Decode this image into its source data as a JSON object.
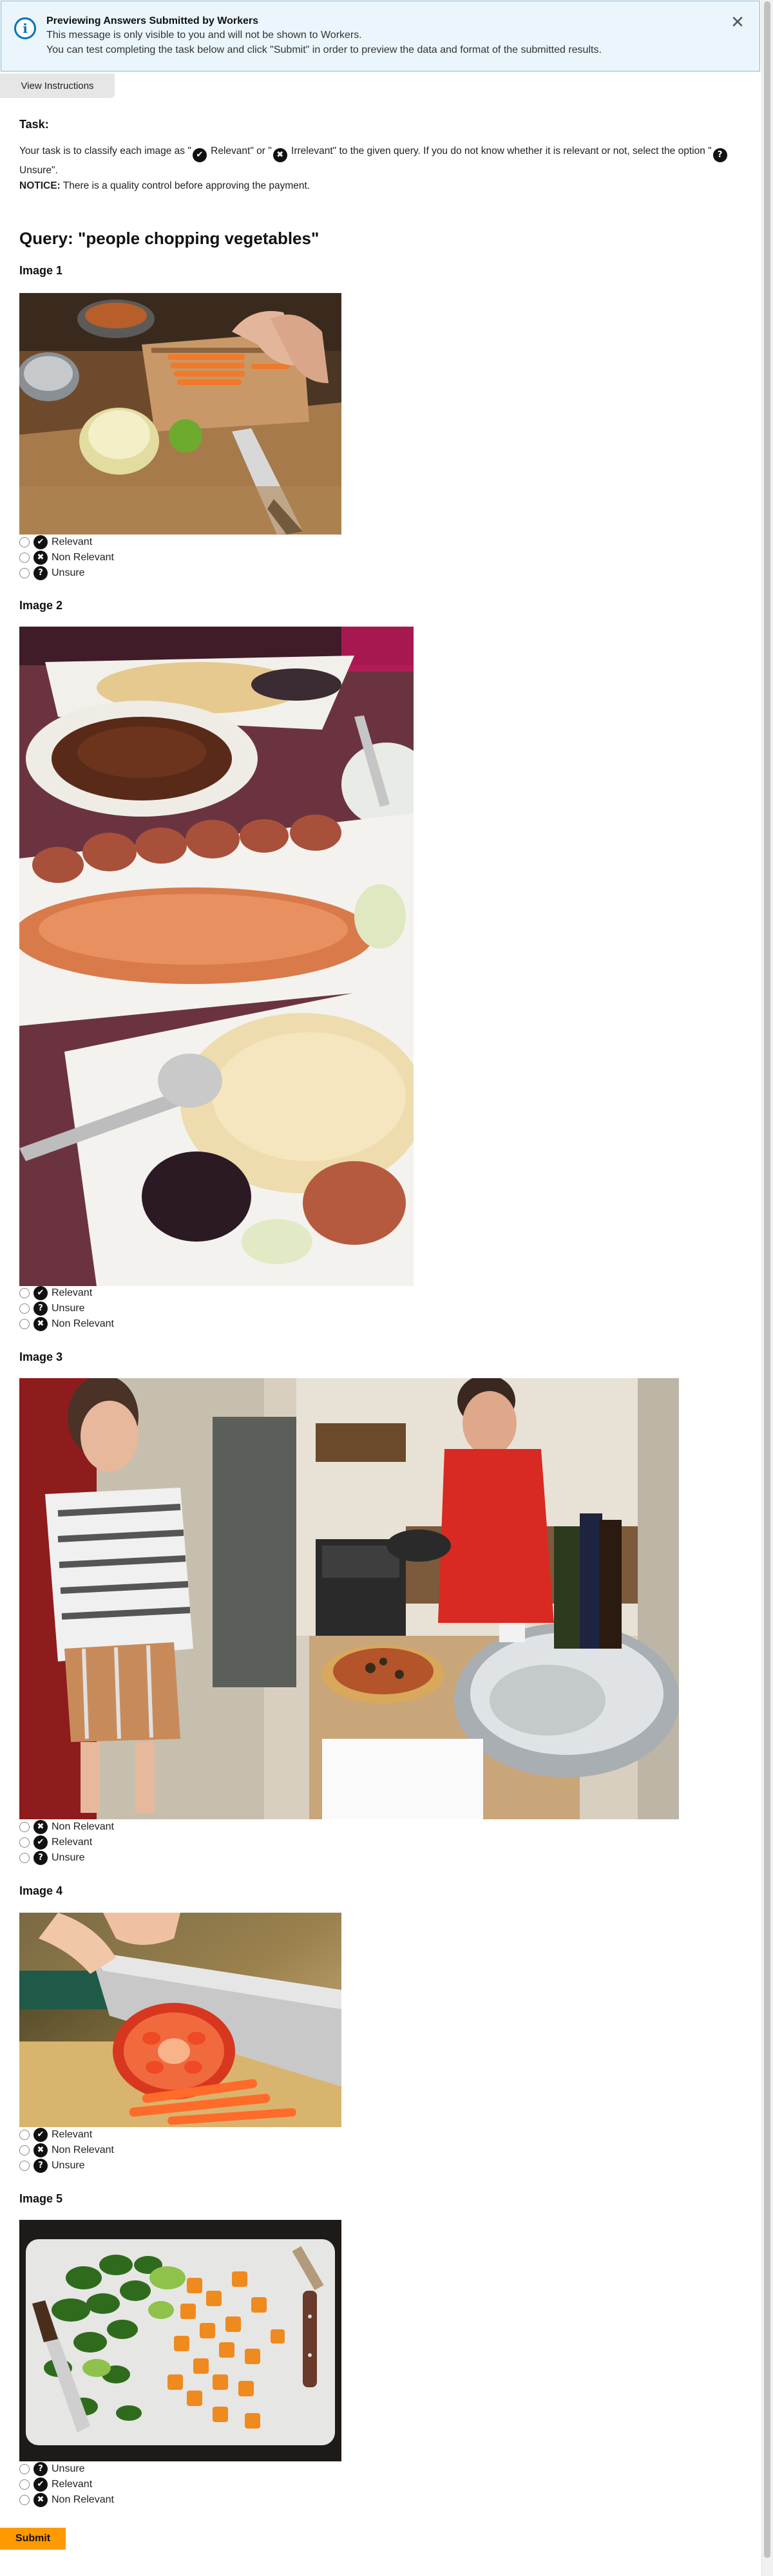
{
  "banner": {
    "title": "Previewing Answers Submitted by Workers",
    "line1": "This message is only visible to you and will not be shown to Workers.",
    "line2": "You can test completing the task below and click \"Submit\" in order to preview the data and format of the submitted results.",
    "info_icon": "i",
    "close_icon": "✕"
  },
  "view_instructions_label": "View Instructions",
  "task": {
    "heading": "Task:",
    "text_part1": "Your task is to classify each image as \"",
    "text_part2": " Relevant\" or \"",
    "text_part3": " Irrelevant\" to the given query. If you do not know whether it is relevant or not, select the option \"",
    "text_part4": " Unsure\".",
    "notice_label": "NOTICE:",
    "notice_text": " There is a quality control before approving the payment."
  },
  "glyphs": {
    "relevant": "✔",
    "non_relevant": "✖",
    "unsure": "?"
  },
  "query": "Query: \"people chopping vegetables\"",
  "images": [
    {
      "title": "Image 1",
      "options": [
        {
          "label": "Relevant",
          "icon": "relevant"
        },
        {
          "label": "Non Relevant",
          "icon": "non_relevant"
        },
        {
          "label": "Unsure",
          "icon": "unsure"
        }
      ]
    },
    {
      "title": "Image 2",
      "options": [
        {
          "label": "Relevant",
          "icon": "relevant"
        },
        {
          "label": "Unsure",
          "icon": "unsure"
        },
        {
          "label": "Non Relevant",
          "icon": "non_relevant"
        }
      ]
    },
    {
      "title": "Image 3",
      "options": [
        {
          "label": "Non Relevant",
          "icon": "non_relevant"
        },
        {
          "label": "Relevant",
          "icon": "relevant"
        },
        {
          "label": "Unsure",
          "icon": "unsure"
        }
      ]
    },
    {
      "title": "Image 4",
      "options": [
        {
          "label": "Relevant",
          "icon": "relevant"
        },
        {
          "label": "Non Relevant",
          "icon": "non_relevant"
        },
        {
          "label": "Unsure",
          "icon": "unsure"
        }
      ]
    },
    {
      "title": "Image 5",
      "options": [
        {
          "label": "Unsure",
          "icon": "unsure"
        },
        {
          "label": "Relevant",
          "icon": "relevant"
        },
        {
          "label": "Non Relevant",
          "icon": "non_relevant"
        }
      ]
    }
  ],
  "submit_label": "Submit",
  "colors": {
    "banner_bg": "#eaf6fb",
    "banner_border": "#7fb9d6",
    "info_blue": "#0073bb",
    "submit_orange": "#ff9900"
  }
}
